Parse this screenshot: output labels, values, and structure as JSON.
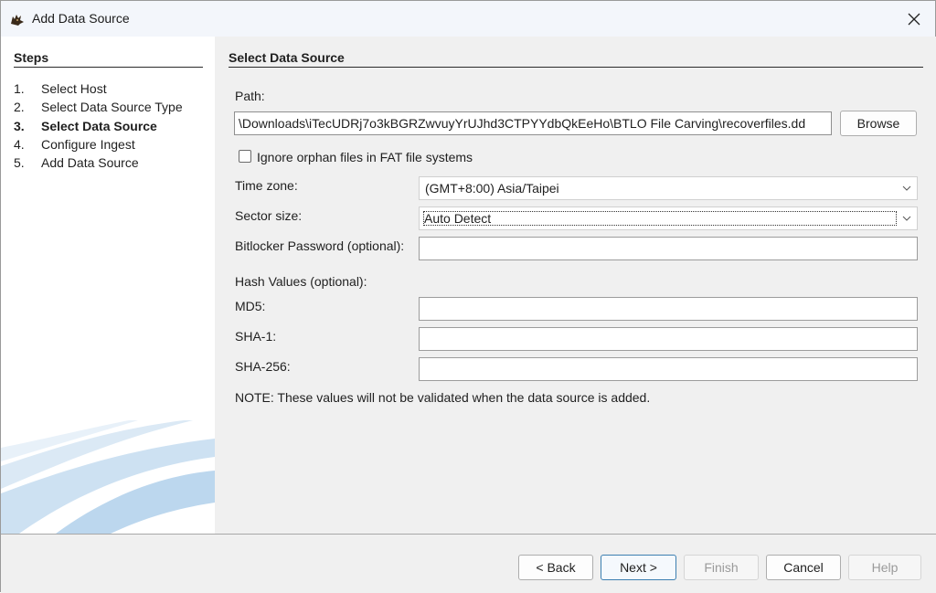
{
  "window": {
    "title": "Add Data Source",
    "icon": "autopsy-dog-icon"
  },
  "steps": {
    "heading": "Steps",
    "items": [
      {
        "num": "1.",
        "label": "Select Host",
        "active": false
      },
      {
        "num": "2.",
        "label": "Select Data Source Type",
        "active": false
      },
      {
        "num": "3.",
        "label": "Select Data Source",
        "active": true
      },
      {
        "num": "4.",
        "label": "Configure Ingest",
        "active": false
      },
      {
        "num": "5.",
        "label": "Add Data Source",
        "active": false
      }
    ]
  },
  "main": {
    "section_title": "Select Data Source",
    "path_label": "Path:",
    "path_value": "\\Downloads\\iTecUDRj7o3kBGRZwvuyYrUJhd3CTPYYdbQkEeHo\\BTLO File Carving\\recoverfiles.dd",
    "browse_label": "Browse",
    "ignore_orphan_label": "Ignore orphan files in FAT file systems",
    "ignore_orphan_checked": false,
    "timezone_label": "Time zone:",
    "timezone_value": "(GMT+8:00) Asia/Taipei",
    "sector_label": "Sector size:",
    "sector_value": "Auto Detect",
    "bitlocker_label": "Bitlocker Password (optional):",
    "bitlocker_value": "",
    "hash_heading": "Hash Values (optional):",
    "md5_label": "MD5:",
    "md5_value": "",
    "sha1_label": "SHA-1:",
    "sha1_value": "",
    "sha256_label": "SHA-256:",
    "sha256_value": "",
    "note": "NOTE: These values will not be validated when the data source is added."
  },
  "footer": {
    "back_label": "< Back",
    "next_label": "Next >",
    "finish_label": "Finish",
    "cancel_label": "Cancel",
    "help_label": "Help"
  },
  "colors": {
    "window_bg": "#f0f0f0",
    "titlebar_bg": "#f3f6fb",
    "primary_border": "#3c7fb1",
    "swoosh": "#cfe3f3"
  }
}
